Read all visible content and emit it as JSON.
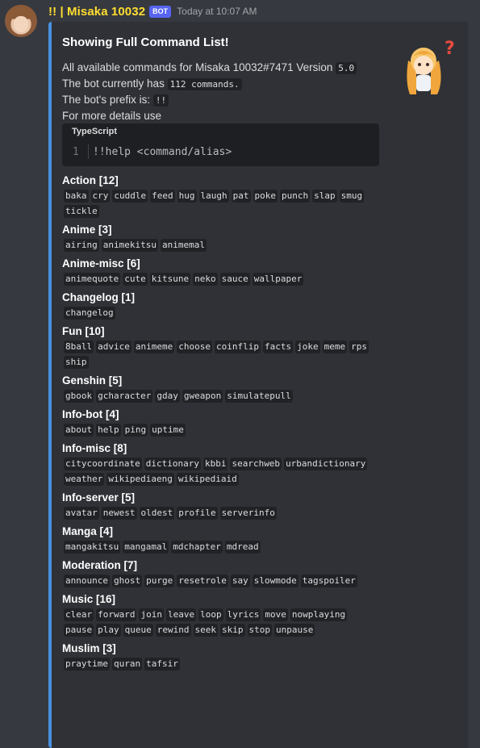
{
  "message": {
    "username": "!! | Misaka 10032",
    "bot_tag": "BOT",
    "timestamp": "Today at 10:07 AM"
  },
  "embed": {
    "accent_color": "#4a90e2",
    "title": "Showing Full Command List!",
    "desc": {
      "line1_prefix": "All available commands for Misaka 10032#7471 Version ",
      "version": "5.0",
      "line2_prefix": "The bot currently has ",
      "commands_count": "112 commands.",
      "line3_prefix": "The bot's prefix is: ",
      "prefix": "!!",
      "line4": "For more details use"
    },
    "codeblock": {
      "language": "TypeScript",
      "line_number": "1",
      "code": "!!help <command/alias>"
    },
    "fields": [
      {
        "name": "Action [12]",
        "commands": [
          "baka",
          "cry",
          "cuddle",
          "feed",
          "hug",
          "laugh",
          "pat",
          "poke",
          "punch",
          "slap",
          "smug",
          "tickle"
        ]
      },
      {
        "name": "Anime [3]",
        "commands": [
          "airing",
          "animekitsu",
          "animemal"
        ]
      },
      {
        "name": "Anime-misc [6]",
        "commands": [
          "animequote",
          "cute",
          "kitsune",
          "neko",
          "sauce",
          "wallpaper"
        ]
      },
      {
        "name": "Changelog [1]",
        "commands": [
          "changelog"
        ]
      },
      {
        "name": "Fun [10]",
        "commands": [
          "8ball",
          "advice",
          "animeme",
          "choose",
          "coinflip",
          "facts",
          "joke",
          "meme",
          "rps",
          "ship"
        ]
      },
      {
        "name": "Genshin [5]",
        "commands": [
          "gbook",
          "gcharacter",
          "gday",
          "gweapon",
          "simulatepull"
        ]
      },
      {
        "name": "Info-bot [4]",
        "commands": [
          "about",
          "help",
          "ping",
          "uptime"
        ]
      },
      {
        "name": "Info-misc [8]",
        "commands": [
          "citycoordinate",
          "dictionary",
          "kbbi",
          "searchweb",
          "urbandictionary",
          "weather",
          "wikipediaeng",
          "wikipediaid"
        ]
      },
      {
        "name": "Info-server [5]",
        "commands": [
          "avatar",
          "newest",
          "oldest",
          "profile",
          "serverinfo"
        ]
      },
      {
        "name": "Manga [4]",
        "commands": [
          "mangakitsu",
          "mangamal",
          "mdchapter",
          "mdread"
        ]
      },
      {
        "name": "Moderation [7]",
        "commands": [
          "announce",
          "ghost",
          "purge",
          "resetrole",
          "say",
          "slowmode",
          "tagspoiler"
        ]
      },
      {
        "name": "Music [16]",
        "commands": [
          "clear",
          "forward",
          "join",
          "leave",
          "loop",
          "lyrics",
          "move",
          "nowplaying",
          "pause",
          "play",
          "queue",
          "rewind",
          "seek",
          "skip",
          "stop",
          "unpause"
        ]
      },
      {
        "name": "Muslim [3]",
        "commands": [
          "praytime",
          "quran",
          "tafsir"
        ]
      }
    ]
  }
}
